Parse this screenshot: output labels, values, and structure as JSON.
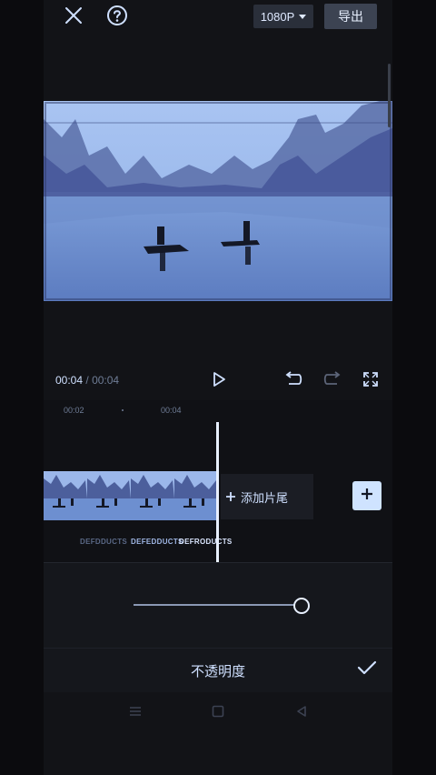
{
  "topbar": {
    "resolution": "1080P",
    "export_label": "导出"
  },
  "playback": {
    "current_time": "00:04",
    "separator": "/",
    "total_time": "00:04"
  },
  "timeline": {
    "ruler_labels": [
      "00:02",
      "00:04"
    ],
    "add_ending_label": "添加片尾",
    "clip_captions": [
      "DEFDDUCTS",
      "DEFEDDUCTS",
      "DEFRODUCTS"
    ]
  },
  "opacity_panel": {
    "title": "不透明度",
    "slider_value": 1.0
  },
  "icons": [
    "close-icon",
    "help-icon",
    "caret-down-icon",
    "play-icon",
    "undo-icon",
    "redo-icon",
    "fullscreen-icon",
    "plus-icon",
    "add-clip-icon",
    "confirm-check-icon",
    "nav-menu-icon",
    "nav-home-icon",
    "nav-back-icon"
  ],
  "colors": {
    "accent": "#cfe3ff",
    "background": "#121317"
  }
}
